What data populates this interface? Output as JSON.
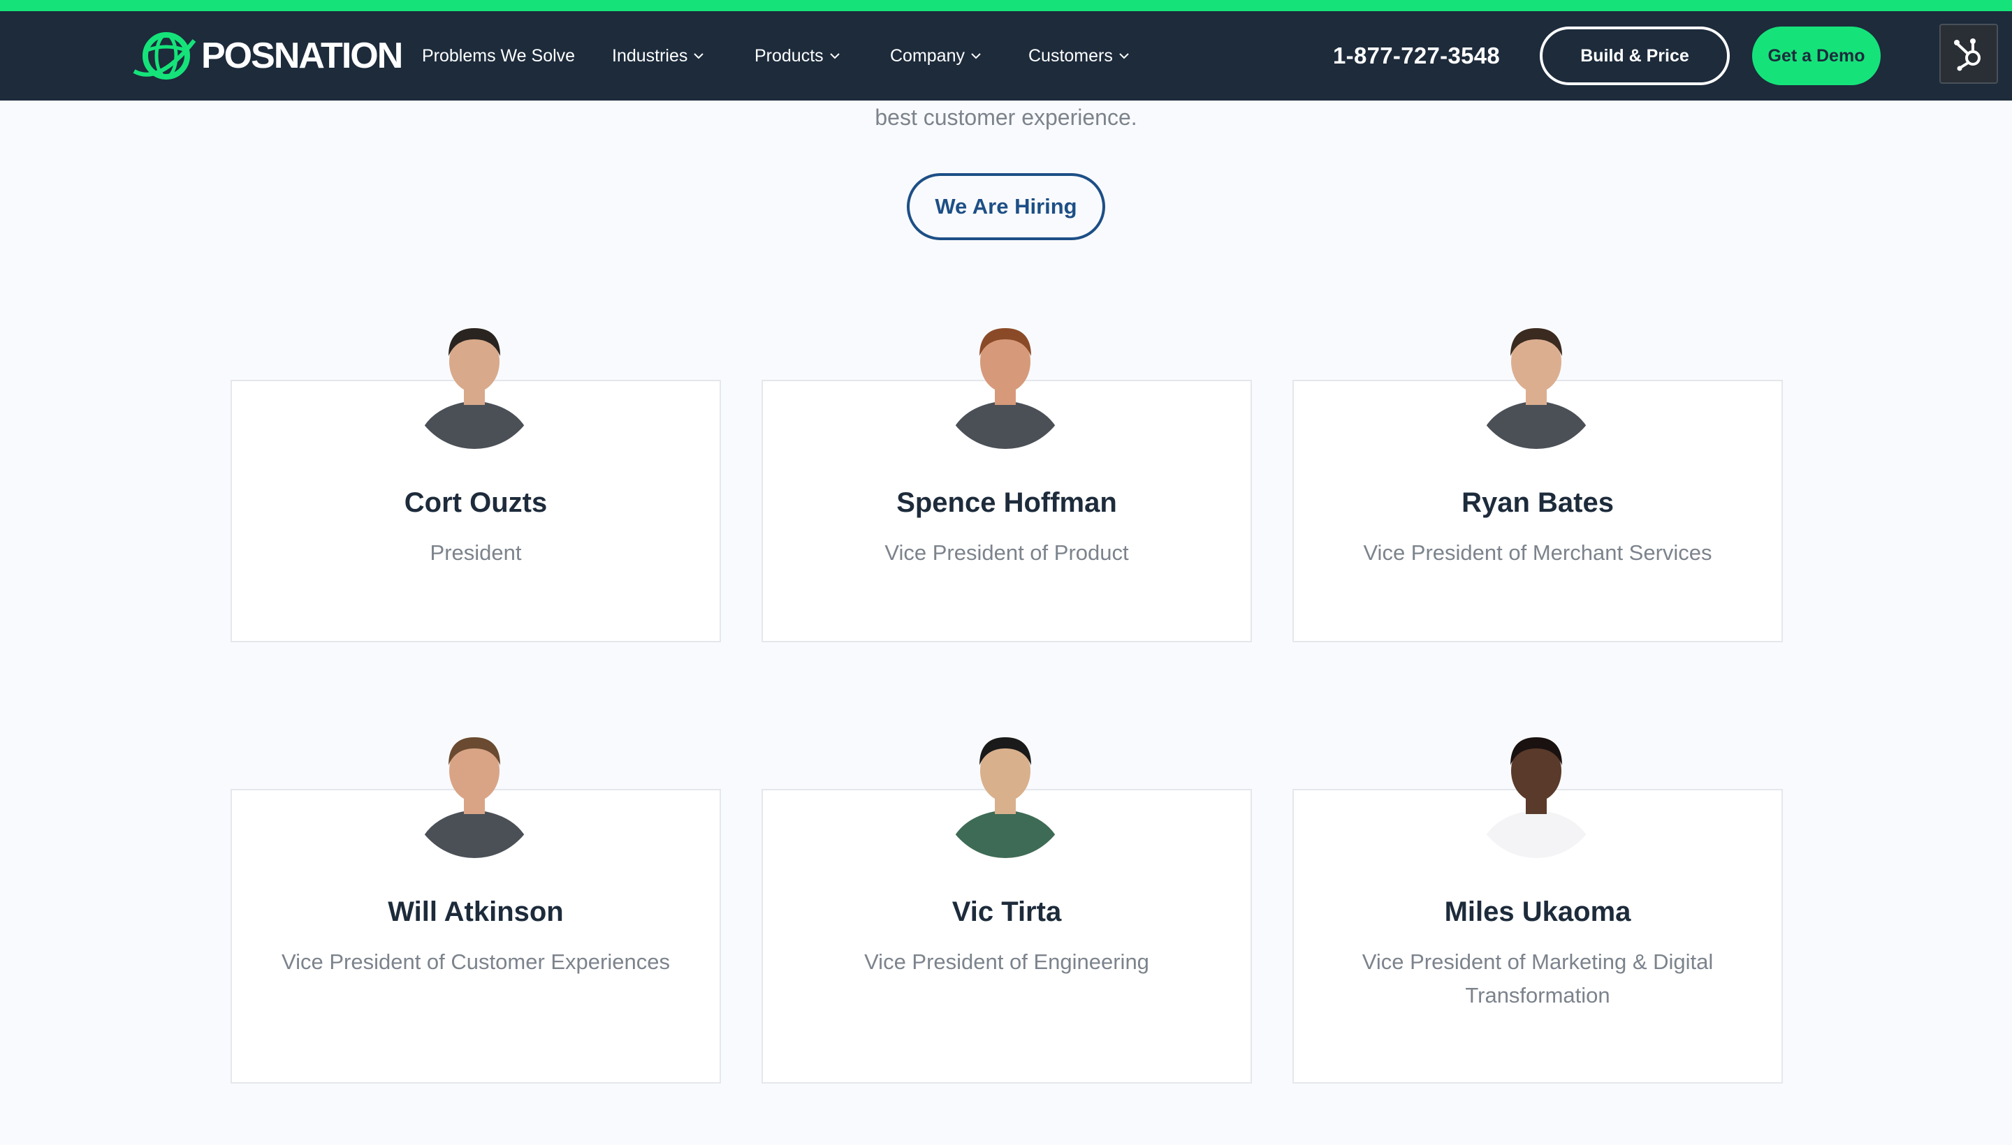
{
  "brand": {
    "name": "POSNATION",
    "accent_color": "#15e37a",
    "nav_bg": "#1d2b3b"
  },
  "nav": {
    "items": [
      {
        "label": "Problems We Solve",
        "has_dropdown": false
      },
      {
        "label": "Industries",
        "has_dropdown": true
      },
      {
        "label": "Products",
        "has_dropdown": true
      },
      {
        "label": "Company",
        "has_dropdown": true
      },
      {
        "label": "Customers",
        "has_dropdown": true
      }
    ],
    "phone": "1-877-727-3548",
    "build_price_label": "Build & Price",
    "demo_label": "Get a Demo",
    "hub_icon": "hubspot-sprocket-icon"
  },
  "intro": {
    "tail_text": "best customer experience.",
    "hiring_label": "We Are Hiring"
  },
  "team": [
    {
      "name": "Cort Ouzts",
      "role": "President",
      "shirt": "#4b5057",
      "skin": "#d8a98a",
      "hair": "#2a2420"
    },
    {
      "name": "Spence Hoffman",
      "role": "Vice President of Product",
      "shirt": "#4b5057",
      "skin": "#d69a7a",
      "hair": "#8a4a28"
    },
    {
      "name": "Ryan Bates",
      "role": "Vice President of Merchant Services",
      "shirt": "#4b5057",
      "skin": "#dcae90",
      "hair": "#3a2a20"
    },
    {
      "name": "Will Atkinson",
      "role": "Vice President of Customer Experiences",
      "shirt": "#4b5057",
      "skin": "#d9a486",
      "hair": "#6a4a30"
    },
    {
      "name": "Vic Tirta",
      "role": "Vice President of Engineering",
      "shirt": "#3e6b55",
      "skin": "#d9b08c",
      "hair": "#1a1a1a"
    },
    {
      "name": "Miles Ukaoma",
      "role": "Vice President of Marketing & Digital Transformation",
      "shirt": "#f4f4f6",
      "skin": "#5a3a2a",
      "hair": "#1a1210"
    }
  ]
}
